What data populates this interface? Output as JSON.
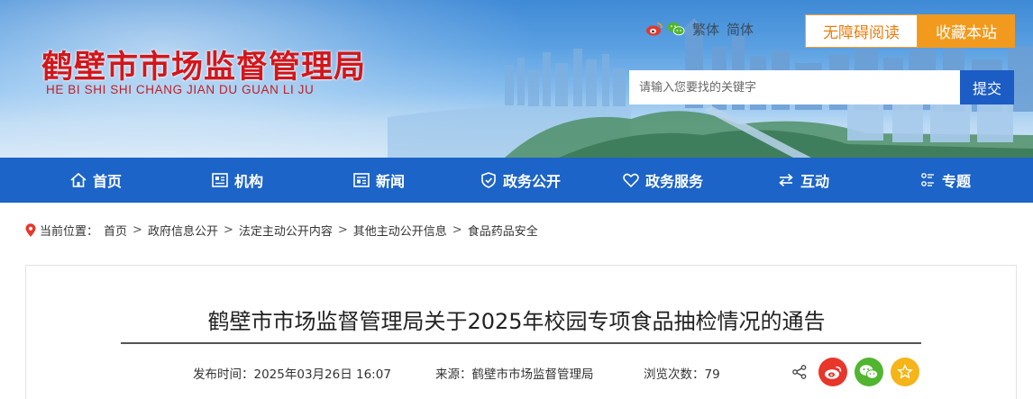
{
  "header": {
    "title": "鹤壁市市场监督管理局",
    "pinyin": "HE BI SHI SHI CHANG JIAN DU GUAN LI JU",
    "lang_traditional": "繁体",
    "lang_simplified": "简体",
    "accessibility_label": "无障碍阅读",
    "favorite_label": "收藏本站",
    "search_placeholder": "请输入您要找的关键字",
    "search_button": "提交"
  },
  "nav": {
    "items": [
      {
        "label": "首页",
        "icon": "home-icon"
      },
      {
        "label": "机构",
        "icon": "org-icon"
      },
      {
        "label": "新闻",
        "icon": "news-icon"
      },
      {
        "label": "政务公开",
        "icon": "shield-icon"
      },
      {
        "label": "政务服务",
        "icon": "heart-icon"
      },
      {
        "label": "互动",
        "icon": "exchange-icon"
      },
      {
        "label": "专题",
        "icon": "topic-icon"
      }
    ]
  },
  "breadcrumb": {
    "prefix": "当前位置：",
    "items": [
      "首页",
      "政府信息公开",
      "法定主动公开内容",
      "其他主动公开信息",
      "食品药品安全"
    ]
  },
  "article": {
    "title": "鹤壁市市场监督管理局关于2025年校园专项食品抽检情况的通告",
    "publish_time": "发布时间：2025年03月26日 16:07",
    "source": "来源：鹤壁市市场监督管理局",
    "views": "浏览次数：79"
  },
  "colors": {
    "nav_bg": "#1d64c8",
    "title_red": "#d3161b",
    "accent_orange": "#f29a1d",
    "search_button": "#1c5cc5"
  }
}
